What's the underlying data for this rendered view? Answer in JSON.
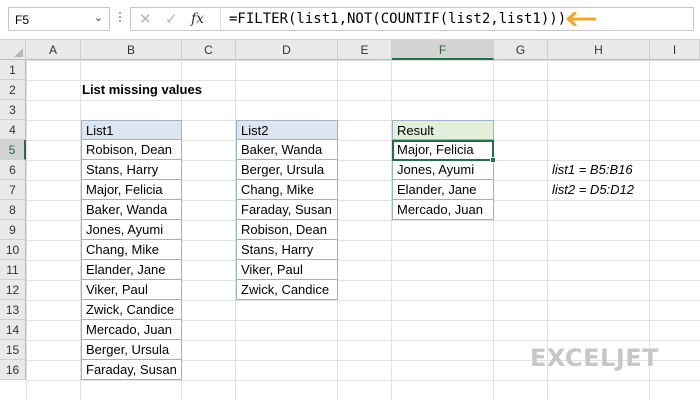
{
  "formula_bar": {
    "name_box": "F5",
    "cancel_glyph": "✕",
    "enter_glyph": "✓",
    "fx_label": "fx",
    "formula": "=FILTER(list1,NOT(COUNTIF(list2,list1)))",
    "arrow_color": "#f5a623"
  },
  "columns": [
    "A",
    "B",
    "C",
    "D",
    "E",
    "F",
    "G",
    "H",
    "I"
  ],
  "active_column": "F",
  "rows": [
    "1",
    "2",
    "3",
    "4",
    "5",
    "6",
    "7",
    "8",
    "9",
    "10",
    "11",
    "12",
    "13",
    "14",
    "15",
    "16"
  ],
  "active_row": "5",
  "sheet": {
    "title": "List missing values",
    "list1": {
      "header": "List1",
      "items": [
        "Robison, Dean",
        "Stans, Harry",
        "Major, Felicia",
        "Baker, Wanda",
        "Jones, Ayumi",
        "Chang, Mike",
        "Elander, Jane",
        "Viker, Paul",
        "Zwick, Candice",
        "Mercado, Juan",
        "Berger, Ursula",
        "Faraday, Susan"
      ]
    },
    "list2": {
      "header": "List2",
      "items": [
        "Baker, Wanda",
        "Berger, Ursula",
        "Chang, Mike",
        "Faraday, Susan",
        "Robison, Dean",
        "Stans, Harry",
        "Viker, Paul",
        "Zwick, Candice"
      ]
    },
    "result": {
      "header": "Result",
      "items": [
        "Major, Felicia",
        "Jones, Ayumi",
        "Elander, Jane",
        "Mercado, Juan"
      ]
    },
    "notes": [
      "list1 = B5:B16",
      "list2 = D5:D12"
    ]
  },
  "logo": {
    "text": "EXCELJET"
  },
  "colors": {
    "list_header_bg": "#dce6f1",
    "result_header_bg": "#e2efda",
    "selection": "#217346"
  }
}
